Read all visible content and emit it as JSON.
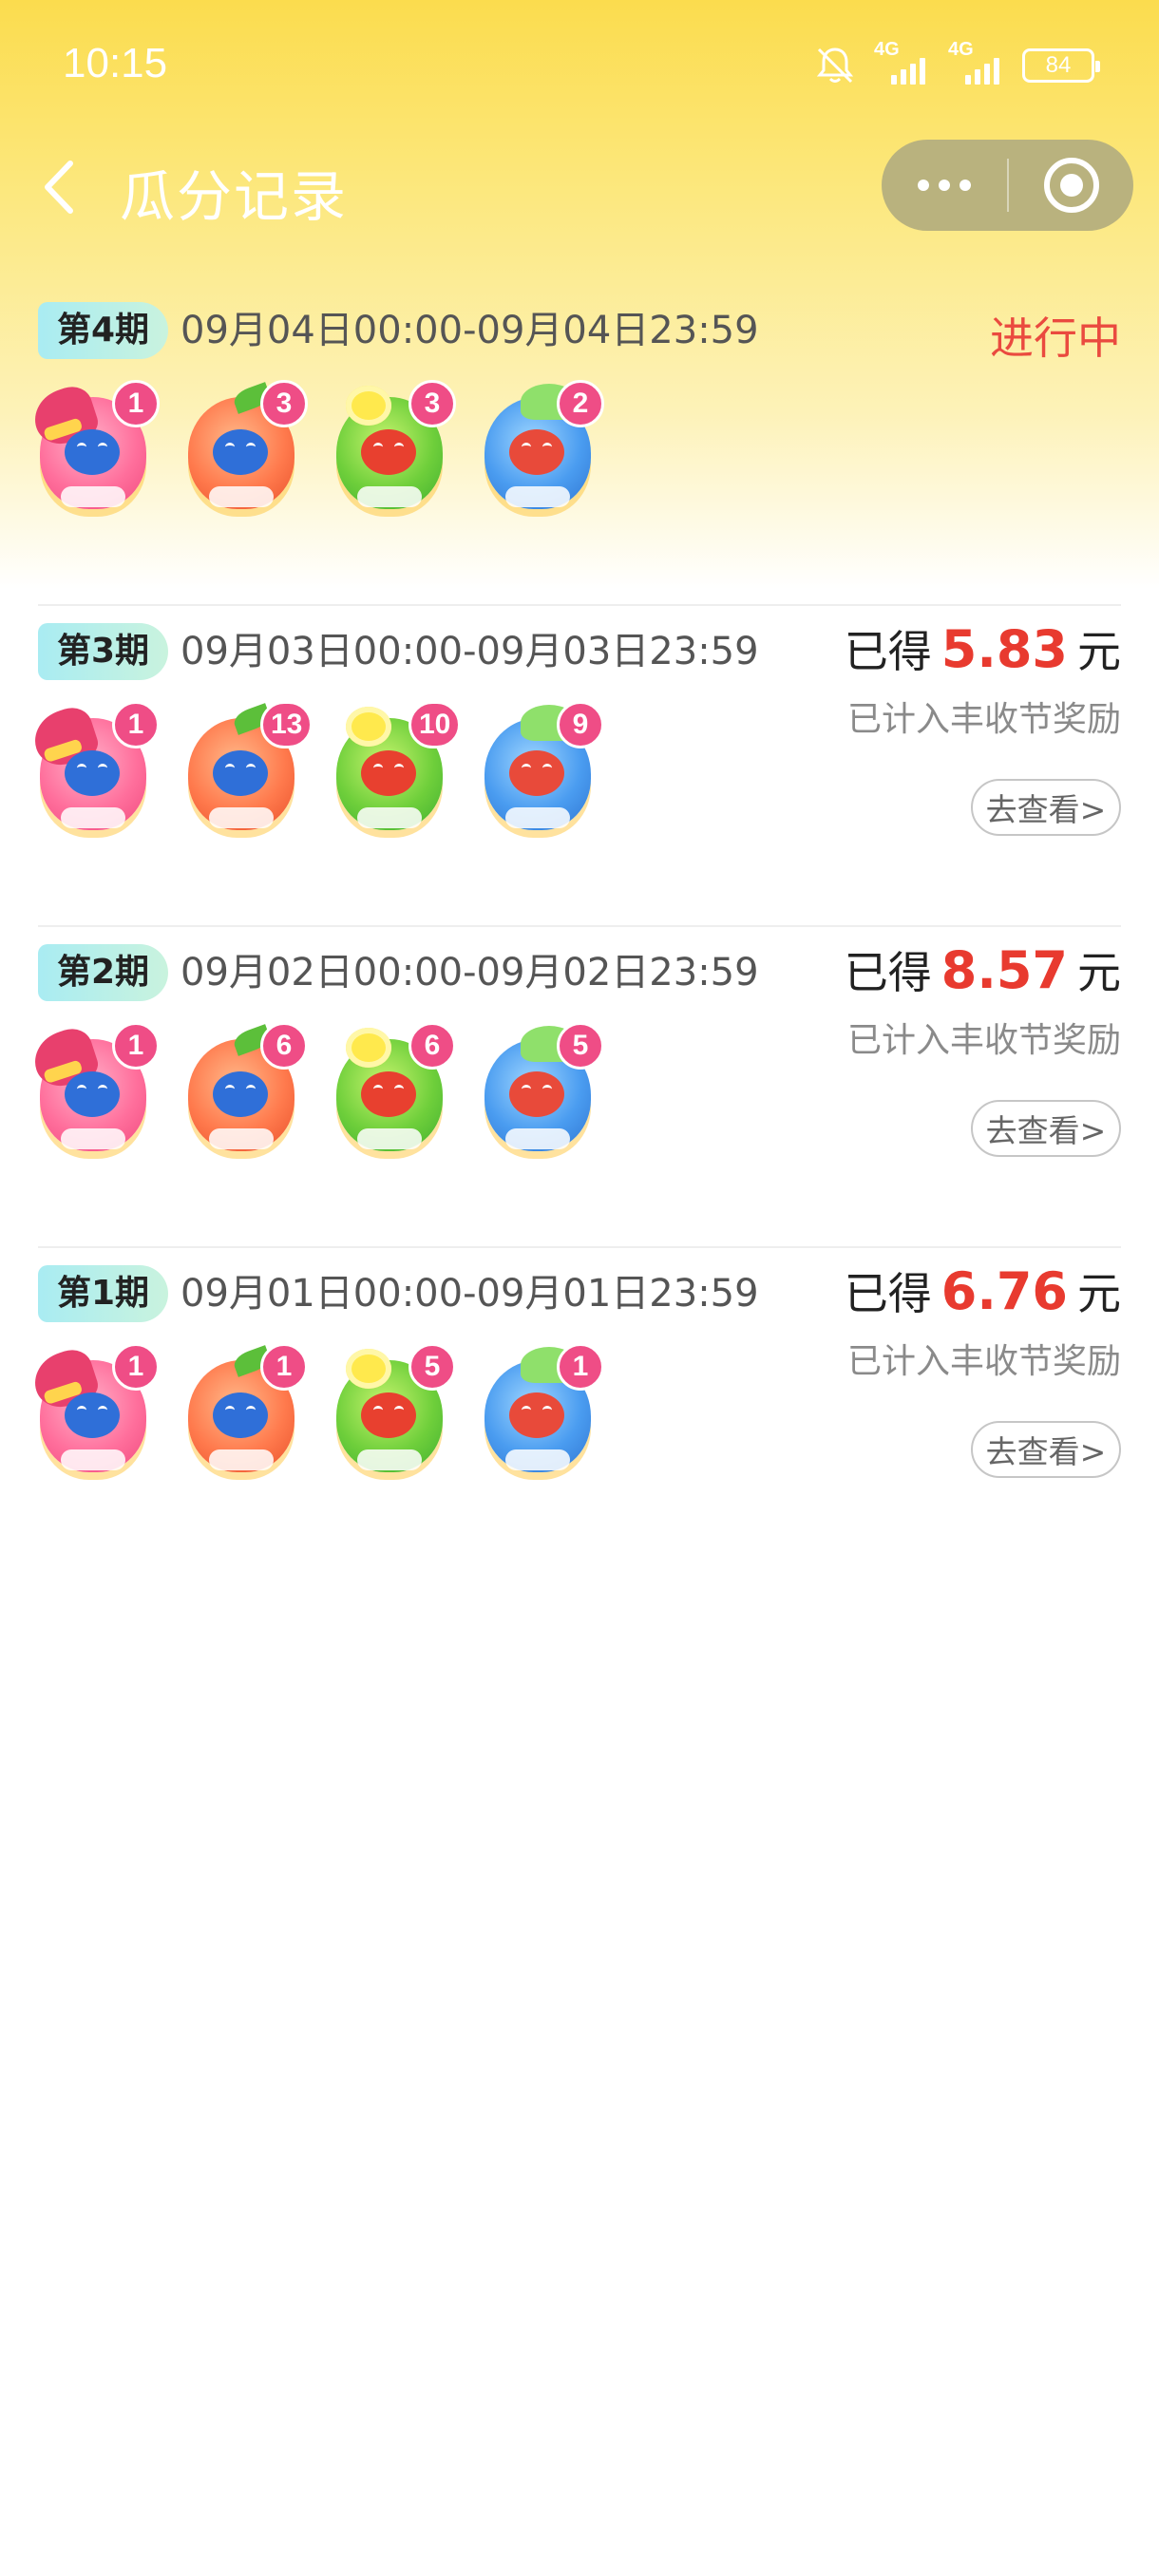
{
  "status_bar": {
    "time": "10:15",
    "network_1": "4G",
    "network_2": "4G",
    "battery": "84"
  },
  "nav": {
    "title": "瓜分记录"
  },
  "periods": [
    {
      "label": "第4期",
      "date_range": "09月04日00:00-09月04日23:59",
      "status": "进行中",
      "beans": [
        {
          "icon": "strawberry-bean-icon",
          "count": "1"
        },
        {
          "icon": "persimmon-bean-icon",
          "count": "3"
        },
        {
          "icon": "osmanthus-bean-icon",
          "count": "3"
        },
        {
          "icon": "lotus-bean-icon",
          "count": "2"
        }
      ]
    },
    {
      "label": "第3期",
      "date_range": "09月03日00:00-09月03日23:59",
      "earned_prefix": "已得",
      "amount": "5.83",
      "unit": "元",
      "note": "已计入丰收节奖励",
      "view": "去查看>",
      "beans": [
        {
          "icon": "strawberry-bean-icon",
          "count": "1"
        },
        {
          "icon": "persimmon-bean-icon",
          "count": "13"
        },
        {
          "icon": "osmanthus-bean-icon",
          "count": "10"
        },
        {
          "icon": "lotus-bean-icon",
          "count": "9"
        }
      ]
    },
    {
      "label": "第2期",
      "date_range": "09月02日00:00-09月02日23:59",
      "earned_prefix": "已得",
      "amount": "8.57",
      "unit": "元",
      "note": "已计入丰收节奖励",
      "view": "去查看>",
      "beans": [
        {
          "icon": "strawberry-bean-icon",
          "count": "1"
        },
        {
          "icon": "persimmon-bean-icon",
          "count": "6"
        },
        {
          "icon": "osmanthus-bean-icon",
          "count": "6"
        },
        {
          "icon": "lotus-bean-icon",
          "count": "5"
        }
      ]
    },
    {
      "label": "第1期",
      "date_range": "09月01日00:00-09月01日23:59",
      "earned_prefix": "已得",
      "amount": "6.76",
      "unit": "元",
      "note": "已计入丰收节奖励",
      "view": "去查看>",
      "beans": [
        {
          "icon": "strawberry-bean-icon",
          "count": "1"
        },
        {
          "icon": "persimmon-bean-icon",
          "count": "1"
        },
        {
          "icon": "osmanthus-bean-icon",
          "count": "5"
        },
        {
          "icon": "lotus-bean-icon",
          "count": "1"
        }
      ]
    }
  ],
  "colors": {
    "header_yellow": "#fbdc4e",
    "accent_red": "#e83a2f",
    "count_badge": "#ef4d86",
    "period_badge": "#a9ecf2"
  }
}
